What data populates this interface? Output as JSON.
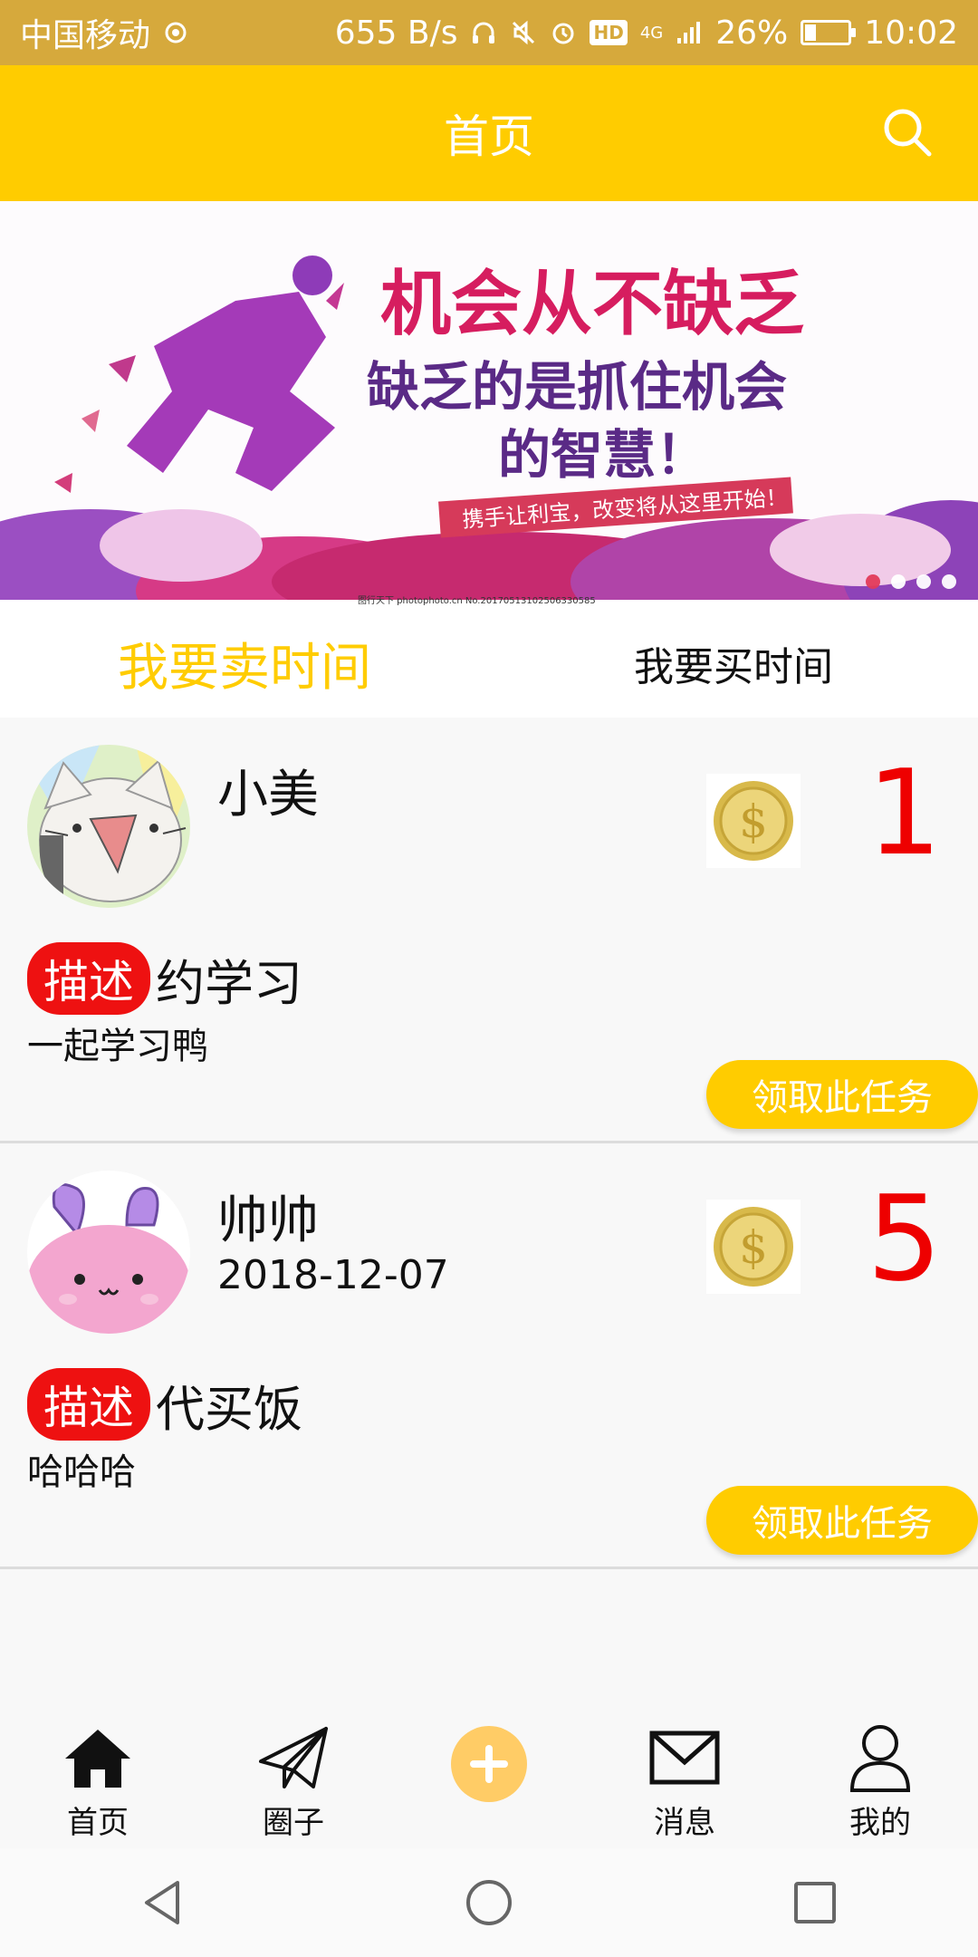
{
  "status_bar": {
    "carrier": "中国移动",
    "net_speed": "655 B/s",
    "network": "4G",
    "hd": "HD",
    "battery": "26%",
    "battery_level": 0.26,
    "time": "10:02"
  },
  "header": {
    "title": "首页",
    "search_icon": "search-icon"
  },
  "banner": {
    "line1": "机会从不缺乏",
    "line2": "缺乏的是抓住机会",
    "line3": "的智慧！",
    "ribbon": "携手让利宝，改变将从这里开始！",
    "watermark": "图行天下 photophoto.cn  No.20170513102506330585",
    "dots": 4,
    "active_dot": 0
  },
  "tabs": [
    {
      "label": "我要卖时间",
      "active": true
    },
    {
      "label": "我要买时间",
      "active": false
    }
  ],
  "tasks": [
    {
      "name": "小美",
      "date": "",
      "price": "1",
      "badge": "描述",
      "title": "约学习",
      "desc": "一起学习鸭",
      "button": "领取此任务"
    },
    {
      "name": "帅帅",
      "date": "2018-12-07",
      "price": "5",
      "badge": "描述",
      "title": "代买饭",
      "desc": "哈哈哈",
      "button": "领取此任务"
    }
  ],
  "bottom_nav": [
    {
      "label": "首页",
      "icon": "home-icon"
    },
    {
      "label": "圈子",
      "icon": "paper-plane-icon"
    },
    {
      "label": "",
      "icon": "plus-icon"
    },
    {
      "label": "消息",
      "icon": "mail-icon"
    },
    {
      "label": "我的",
      "icon": "user-icon"
    }
  ],
  "colors": {
    "accent": "#ffcc00",
    "status_bar": "#d6a93c",
    "price": "#ee0000",
    "badge": "#ee1111",
    "plus": "#ffcc66"
  }
}
